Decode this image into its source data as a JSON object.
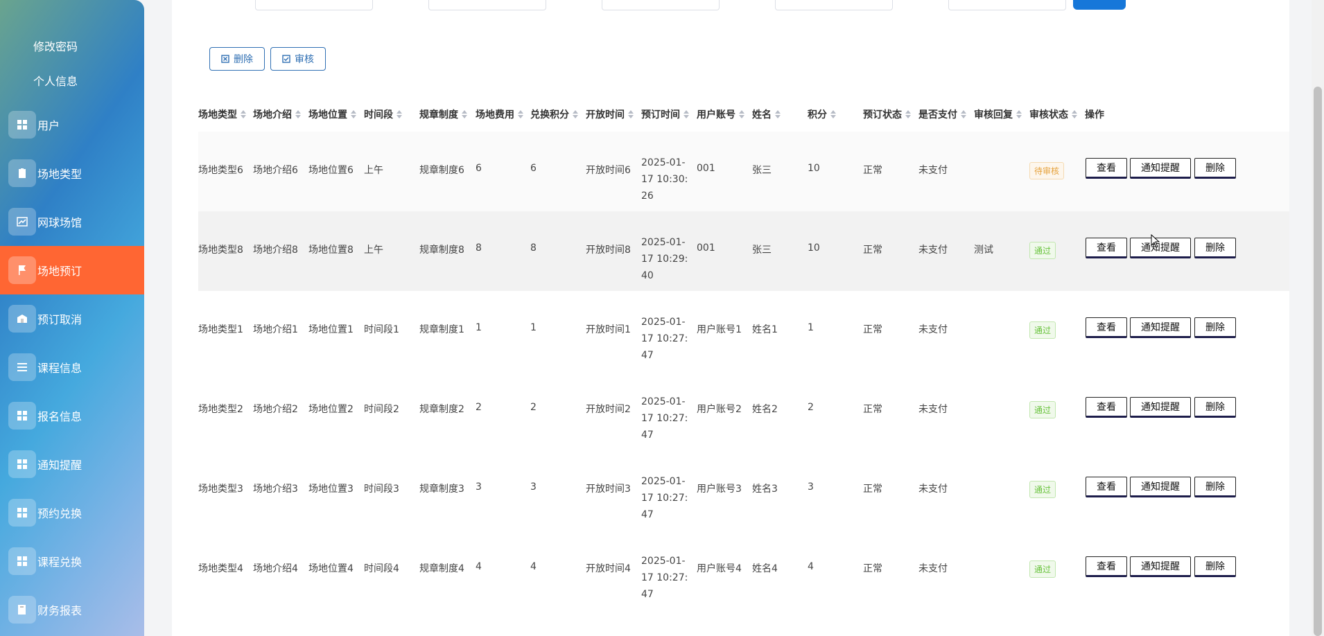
{
  "sidebar": {
    "links": [
      "修改密码",
      "个人信息"
    ],
    "items": [
      {
        "label": "用户",
        "icon": "grid-icon"
      },
      {
        "label": "场地类型",
        "icon": "clipboard-icon"
      },
      {
        "label": "网球场馆",
        "icon": "chart-icon"
      },
      {
        "label": "场地预订",
        "icon": "flag-icon",
        "active": true
      },
      {
        "label": "预订取消",
        "icon": "box-icon"
      },
      {
        "label": "课程信息",
        "icon": "list-icon"
      },
      {
        "label": "报名信息",
        "icon": "grid-icon"
      },
      {
        "label": "通知提醒",
        "icon": "grid-icon"
      },
      {
        "label": "预约兑换",
        "icon": "grid-icon"
      },
      {
        "label": "课程兑换",
        "icon": "grid-icon"
      },
      {
        "label": "财务报表",
        "icon": "book-icon"
      }
    ]
  },
  "toolbar": {
    "delete_label": "删除",
    "review_label": "审核"
  },
  "table": {
    "headers": [
      "场地类型",
      "场地介绍",
      "场地位置",
      "时间段",
      "规章制度",
      "场地费用",
      "兑换积分",
      "开放时间",
      "预订时间",
      "用户账号",
      "姓名",
      "积分",
      "预订状态",
      "是否支付",
      "审核回复",
      "审核状态",
      "操作"
    ],
    "rows": [
      {
        "type": "场地类型6",
        "intro": "场地介绍6",
        "location": "场地位置6",
        "period": "上午",
        "rules": "规章制度6",
        "fee": "6",
        "points_exchange": "6",
        "open_time": "开放时间6",
        "book_time": "2025-01-17 10:30:26",
        "account": "001",
        "name": "张三",
        "points": "10",
        "book_status": "正常",
        "paid": "未支付",
        "reply": "",
        "review_status": "待审核",
        "review_kind": "pending"
      },
      {
        "type": "场地类型8",
        "intro": "场地介绍8",
        "location": "场地位置8",
        "period": "上午",
        "rules": "规章制度8",
        "fee": "8",
        "points_exchange": "8",
        "open_time": "开放时间8",
        "book_time": "2025-01-17 10:29:40",
        "account": "001",
        "name": "张三",
        "points": "10",
        "book_status": "正常",
        "paid": "未支付",
        "reply": "测试",
        "review_status": "通过",
        "review_kind": "pass"
      },
      {
        "type": "场地类型1",
        "intro": "场地介绍1",
        "location": "场地位置1",
        "period": "时间段1",
        "rules": "规章制度1",
        "fee": "1",
        "points_exchange": "1",
        "open_time": "开放时间1",
        "book_time": "2025-01-17 10:27:47",
        "account": "用户账号1",
        "name": "姓名1",
        "points": "1",
        "book_status": "正常",
        "paid": "未支付",
        "reply": "",
        "review_status": "通过",
        "review_kind": "pass"
      },
      {
        "type": "场地类型2",
        "intro": "场地介绍2",
        "location": "场地位置2",
        "period": "时间段2",
        "rules": "规章制度2",
        "fee": "2",
        "points_exchange": "2",
        "open_time": "开放时间2",
        "book_time": "2025-01-17 10:27:47",
        "account": "用户账号2",
        "name": "姓名2",
        "points": "2",
        "book_status": "正常",
        "paid": "未支付",
        "reply": "",
        "review_status": "通过",
        "review_kind": "pass"
      },
      {
        "type": "场地类型3",
        "intro": "场地介绍3",
        "location": "场地位置3",
        "period": "时间段3",
        "rules": "规章制度3",
        "fee": "3",
        "points_exchange": "3",
        "open_time": "开放时间3",
        "book_time": "2025-01-17 10:27:47",
        "account": "用户账号3",
        "name": "姓名3",
        "points": "3",
        "book_status": "正常",
        "paid": "未支付",
        "reply": "",
        "review_status": "通过",
        "review_kind": "pass"
      },
      {
        "type": "场地类型4",
        "intro": "场地介绍4",
        "location": "场地位置4",
        "period": "时间段4",
        "rules": "规章制度4",
        "fee": "4",
        "points_exchange": "4",
        "open_time": "开放时间4",
        "book_time": "2025-01-17 10:27:47",
        "account": "用户账号4",
        "name": "姓名4",
        "points": "4",
        "book_status": "正常",
        "paid": "未支付",
        "reply": "",
        "review_status": "通过",
        "review_kind": "pass"
      }
    ],
    "row_actions": {
      "view": "查看",
      "notify": "通知提醒",
      "delete": "删除"
    }
  }
}
